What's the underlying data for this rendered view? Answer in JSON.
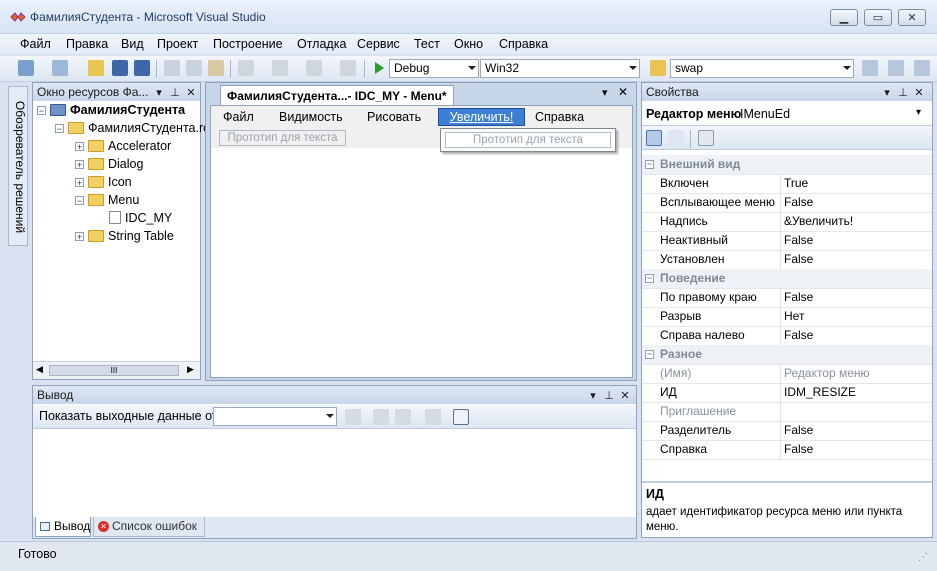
{
  "window": {
    "title": "ФамилияСтудента - Microsoft Visual Studio",
    "minimize_icon": "minimize-icon",
    "maximize_icon": "maximize-icon",
    "close_icon": "close-icon"
  },
  "menubar": {
    "items": [
      "Файл",
      "Правка",
      "Вид",
      "Проект",
      "Построение",
      "Отладка",
      "Сервис",
      "Тест",
      "Окно",
      "Справка"
    ]
  },
  "toolbar": {
    "configuration": "Debug",
    "platform": "Win32",
    "find_value": "swap"
  },
  "solution_explorer_tab": "Обозреватель решений",
  "resource_view": {
    "title": "Окно ресурсов Фа...",
    "tree": [
      {
        "label": "ФамилияСтудента",
        "bold": true
      },
      {
        "label": "ФамилияСтудента.rc"
      },
      {
        "label": "Accelerator"
      },
      {
        "label": "Dialog"
      },
      {
        "label": "Icon"
      },
      {
        "label": "Menu"
      },
      {
        "label": "IDC_MY"
      },
      {
        "label": "String Table"
      }
    ],
    "scroll_label": "III"
  },
  "editor": {
    "tab_title": "ФамилияСтудента...- IDC_MY - Menu*",
    "menu_items": [
      "Файл",
      "Видимость",
      "Рисовать",
      "Увеличить!",
      "Справка"
    ],
    "prototype_text": "Прототип для текста",
    "dropdown_prototype_text": "Прототип для текста"
  },
  "output": {
    "title": "Вывод",
    "show_output_from_label": "Показать выходные данные от:",
    "tabs": [
      "Вывод",
      "Список ошибок"
    ]
  },
  "properties": {
    "title": "Свойства",
    "object_name": "Редактор меню",
    "object_type": "IMenuEd",
    "categories": [
      {
        "name": "Внешний вид",
        "rows": [
          {
            "name": "Включен",
            "value": "True"
          },
          {
            "name": "Всплывающее меню",
            "value": "False"
          },
          {
            "name": "Надпись",
            "value": "&Увеличить!"
          },
          {
            "name": "Неактивный",
            "value": "False"
          },
          {
            "name": "Установлен",
            "value": "False"
          }
        ]
      },
      {
        "name": "Поведение",
        "rows": [
          {
            "name": "По правому краю",
            "value": "False"
          },
          {
            "name": "Разрыв",
            "value": "Нет"
          },
          {
            "name": "Справа налево",
            "value": "False"
          }
        ]
      },
      {
        "name": "Разное",
        "rows": [
          {
            "name": "(Имя)",
            "value": "Редактор меню"
          },
          {
            "name": "ИД",
            "value": "IDM_RESIZE"
          },
          {
            "name": "Приглашение",
            "value": ""
          },
          {
            "name": "Разделитель",
            "value": "False"
          },
          {
            "name": "Справка",
            "value": "False"
          }
        ]
      }
    ],
    "description_title": "ИД",
    "description_text": "адает идентификатор ресурса меню или пункта меню."
  },
  "status": {
    "text": "Готово"
  }
}
